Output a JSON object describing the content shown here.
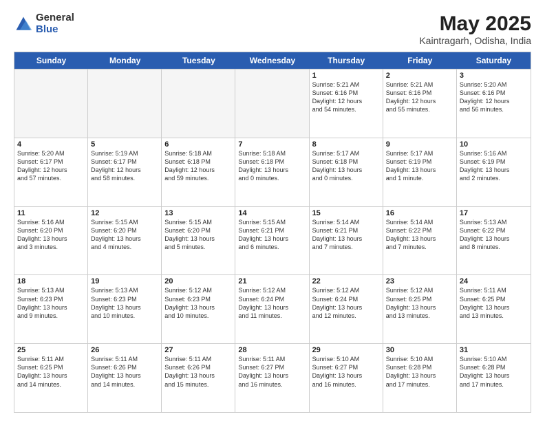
{
  "logo": {
    "general": "General",
    "blue": "Blue"
  },
  "title": "May 2025",
  "location": "Kaintragarh, Odisha, India",
  "header": {
    "days": [
      "Sunday",
      "Monday",
      "Tuesday",
      "Wednesday",
      "Thursday",
      "Friday",
      "Saturday"
    ]
  },
  "rows": [
    [
      {
        "day": "",
        "empty": true
      },
      {
        "day": "",
        "empty": true
      },
      {
        "day": "",
        "empty": true
      },
      {
        "day": "",
        "empty": true
      },
      {
        "day": "1",
        "line1": "Sunrise: 5:21 AM",
        "line2": "Sunset: 6:16 PM",
        "line3": "Daylight: 12 hours",
        "line4": "and 54 minutes."
      },
      {
        "day": "2",
        "line1": "Sunrise: 5:21 AM",
        "line2": "Sunset: 6:16 PM",
        "line3": "Daylight: 12 hours",
        "line4": "and 55 minutes."
      },
      {
        "day": "3",
        "line1": "Sunrise: 5:20 AM",
        "line2": "Sunset: 6:16 PM",
        "line3": "Daylight: 12 hours",
        "line4": "and 56 minutes."
      }
    ],
    [
      {
        "day": "4",
        "line1": "Sunrise: 5:20 AM",
        "line2": "Sunset: 6:17 PM",
        "line3": "Daylight: 12 hours",
        "line4": "and 57 minutes."
      },
      {
        "day": "5",
        "line1": "Sunrise: 5:19 AM",
        "line2": "Sunset: 6:17 PM",
        "line3": "Daylight: 12 hours",
        "line4": "and 58 minutes."
      },
      {
        "day": "6",
        "line1": "Sunrise: 5:18 AM",
        "line2": "Sunset: 6:18 PM",
        "line3": "Daylight: 12 hours",
        "line4": "and 59 minutes."
      },
      {
        "day": "7",
        "line1": "Sunrise: 5:18 AM",
        "line2": "Sunset: 6:18 PM",
        "line3": "Daylight: 13 hours",
        "line4": "and 0 minutes."
      },
      {
        "day": "8",
        "line1": "Sunrise: 5:17 AM",
        "line2": "Sunset: 6:18 PM",
        "line3": "Daylight: 13 hours",
        "line4": "and 0 minutes."
      },
      {
        "day": "9",
        "line1": "Sunrise: 5:17 AM",
        "line2": "Sunset: 6:19 PM",
        "line3": "Daylight: 13 hours",
        "line4": "and 1 minute."
      },
      {
        "day": "10",
        "line1": "Sunrise: 5:16 AM",
        "line2": "Sunset: 6:19 PM",
        "line3": "Daylight: 13 hours",
        "line4": "and 2 minutes."
      }
    ],
    [
      {
        "day": "11",
        "line1": "Sunrise: 5:16 AM",
        "line2": "Sunset: 6:20 PM",
        "line3": "Daylight: 13 hours",
        "line4": "and 3 minutes."
      },
      {
        "day": "12",
        "line1": "Sunrise: 5:15 AM",
        "line2": "Sunset: 6:20 PM",
        "line3": "Daylight: 13 hours",
        "line4": "and 4 minutes."
      },
      {
        "day": "13",
        "line1": "Sunrise: 5:15 AM",
        "line2": "Sunset: 6:20 PM",
        "line3": "Daylight: 13 hours",
        "line4": "and 5 minutes."
      },
      {
        "day": "14",
        "line1": "Sunrise: 5:15 AM",
        "line2": "Sunset: 6:21 PM",
        "line3": "Daylight: 13 hours",
        "line4": "and 6 minutes."
      },
      {
        "day": "15",
        "line1": "Sunrise: 5:14 AM",
        "line2": "Sunset: 6:21 PM",
        "line3": "Daylight: 13 hours",
        "line4": "and 7 minutes."
      },
      {
        "day": "16",
        "line1": "Sunrise: 5:14 AM",
        "line2": "Sunset: 6:22 PM",
        "line3": "Daylight: 13 hours",
        "line4": "and 7 minutes."
      },
      {
        "day": "17",
        "line1": "Sunrise: 5:13 AM",
        "line2": "Sunset: 6:22 PM",
        "line3": "Daylight: 13 hours",
        "line4": "and 8 minutes."
      }
    ],
    [
      {
        "day": "18",
        "line1": "Sunrise: 5:13 AM",
        "line2": "Sunset: 6:23 PM",
        "line3": "Daylight: 13 hours",
        "line4": "and 9 minutes."
      },
      {
        "day": "19",
        "line1": "Sunrise: 5:13 AM",
        "line2": "Sunset: 6:23 PM",
        "line3": "Daylight: 13 hours",
        "line4": "and 10 minutes."
      },
      {
        "day": "20",
        "line1": "Sunrise: 5:12 AM",
        "line2": "Sunset: 6:23 PM",
        "line3": "Daylight: 13 hours",
        "line4": "and 10 minutes."
      },
      {
        "day": "21",
        "line1": "Sunrise: 5:12 AM",
        "line2": "Sunset: 6:24 PM",
        "line3": "Daylight: 13 hours",
        "line4": "and 11 minutes."
      },
      {
        "day": "22",
        "line1": "Sunrise: 5:12 AM",
        "line2": "Sunset: 6:24 PM",
        "line3": "Daylight: 13 hours",
        "line4": "and 12 minutes."
      },
      {
        "day": "23",
        "line1": "Sunrise: 5:12 AM",
        "line2": "Sunset: 6:25 PM",
        "line3": "Daylight: 13 hours",
        "line4": "and 13 minutes."
      },
      {
        "day": "24",
        "line1": "Sunrise: 5:11 AM",
        "line2": "Sunset: 6:25 PM",
        "line3": "Daylight: 13 hours",
        "line4": "and 13 minutes."
      }
    ],
    [
      {
        "day": "25",
        "line1": "Sunrise: 5:11 AM",
        "line2": "Sunset: 6:25 PM",
        "line3": "Daylight: 13 hours",
        "line4": "and 14 minutes."
      },
      {
        "day": "26",
        "line1": "Sunrise: 5:11 AM",
        "line2": "Sunset: 6:26 PM",
        "line3": "Daylight: 13 hours",
        "line4": "and 14 minutes."
      },
      {
        "day": "27",
        "line1": "Sunrise: 5:11 AM",
        "line2": "Sunset: 6:26 PM",
        "line3": "Daylight: 13 hours",
        "line4": "and 15 minutes."
      },
      {
        "day": "28",
        "line1": "Sunrise: 5:11 AM",
        "line2": "Sunset: 6:27 PM",
        "line3": "Daylight: 13 hours",
        "line4": "and 16 minutes."
      },
      {
        "day": "29",
        "line1": "Sunrise: 5:10 AM",
        "line2": "Sunset: 6:27 PM",
        "line3": "Daylight: 13 hours",
        "line4": "and 16 minutes."
      },
      {
        "day": "30",
        "line1": "Sunrise: 5:10 AM",
        "line2": "Sunset: 6:28 PM",
        "line3": "Daylight: 13 hours",
        "line4": "and 17 minutes."
      },
      {
        "day": "31",
        "line1": "Sunrise: 5:10 AM",
        "line2": "Sunset: 6:28 PM",
        "line3": "Daylight: 13 hours",
        "line4": "and 17 minutes."
      }
    ]
  ]
}
